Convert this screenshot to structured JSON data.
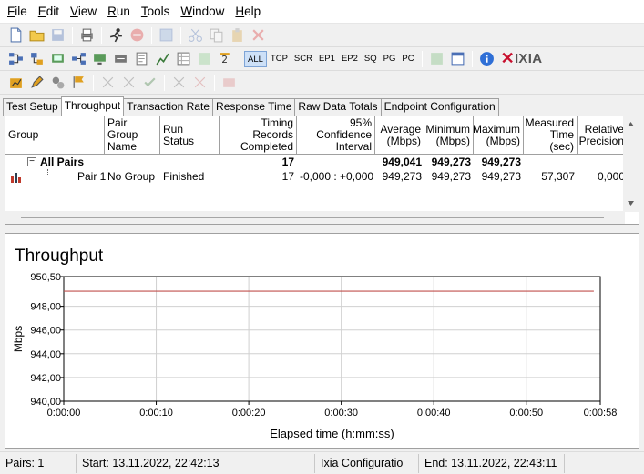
{
  "menu": [
    {
      "key": "file",
      "label": "File"
    },
    {
      "key": "edit",
      "label": "Edit"
    },
    {
      "key": "view",
      "label": "View"
    },
    {
      "key": "run",
      "label": "Run"
    },
    {
      "key": "tools",
      "label": "Tools"
    },
    {
      "key": "window",
      "label": "Window"
    },
    {
      "key": "help",
      "label": "Help"
    }
  ],
  "toolbar2": {
    "protocol_buttons": [
      "ALL",
      "TCP",
      "SCR",
      "EP1",
      "EP2",
      "SQ",
      "PG",
      "PC"
    ],
    "active_protocol": "ALL",
    "brand": "IXIA"
  },
  "tabs": [
    "Test Setup",
    "Throughput",
    "Transaction Rate",
    "Response Time",
    "Raw Data Totals",
    "Endpoint Configuration"
  ],
  "active_tab": "Throughput",
  "grid": {
    "columns": [
      {
        "label": "Group",
        "align": "left"
      },
      {
        "label": "Pair Group Name",
        "align": "left"
      },
      {
        "label": "Run Status",
        "align": "left"
      },
      {
        "label": "Timing Records Completed",
        "align": "right"
      },
      {
        "label": "95% Confidence Interval",
        "align": "right"
      },
      {
        "label": "Average (Mbps)",
        "align": "right"
      },
      {
        "label": "Minimum (Mbps)",
        "align": "right"
      },
      {
        "label": "Maximum (Mbps)",
        "align": "right"
      },
      {
        "label": "Measured Time (sec)",
        "align": "right"
      },
      {
        "label": "Relative Precision",
        "align": "right"
      }
    ],
    "summary_row": {
      "group": "All Pairs",
      "records": "17",
      "average": "949,041",
      "minimum": "949,273",
      "maximum": "949,273"
    },
    "pair_row": {
      "group": "Pair 1",
      "pair_group_name": "No Group",
      "run_status": "Finished",
      "records": "17",
      "confidence": "-0,000 : +0,000",
      "average": "949,273",
      "minimum": "949,273",
      "maximum": "949,273",
      "measured_time": "57,307",
      "relative_precision": "0,000"
    }
  },
  "chart_data": {
    "type": "line",
    "title": "Throughput",
    "xlabel": "Elapsed time (h:mm:ss)",
    "ylabel": "Mbps",
    "ylim": [
      940.0,
      950.5
    ],
    "xlim": [
      0,
      58
    ],
    "yticks": [
      "950,50",
      "948,00",
      "946,00",
      "944,00",
      "942,00",
      "940,00"
    ],
    "ytick_values": [
      950.5,
      948.0,
      946.0,
      944.0,
      942.0,
      940.0
    ],
    "xticks": [
      "0:00:00",
      "0:00:10",
      "0:00:20",
      "0:00:30",
      "0:00:40",
      "0:00:50",
      "0:00:58"
    ],
    "xtick_values": [
      0,
      10,
      20,
      30,
      40,
      50,
      58
    ],
    "grid": true,
    "series": [
      {
        "color": "#c0504d",
        "x": [
          0,
          57.3
        ],
        "y": [
          949.27,
          949.27
        ]
      }
    ]
  },
  "status": {
    "pairs": "Pairs: 1",
    "start": "Start: 13.11.2022, 22:42:13",
    "config": "Ixia Configuratio",
    "end": "End: 13.11.2022, 22:43:11"
  },
  "colors": {
    "accent": "#c8102e",
    "series": "#c0504d"
  }
}
